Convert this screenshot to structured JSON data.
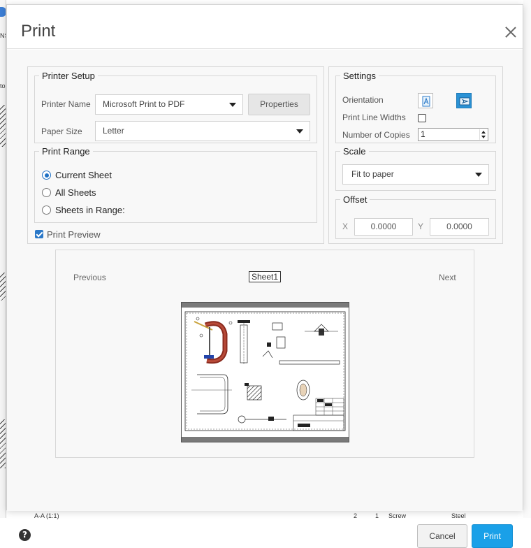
{
  "dialog": {
    "title": "Print"
  },
  "printer_setup": {
    "legend": "Printer Setup",
    "printer_name_label": "Printer Name",
    "printer_name_value": "Microsoft Print to PDF",
    "properties_button": "Properties",
    "paper_size_label": "Paper Size",
    "paper_size_value": "Letter"
  },
  "print_range": {
    "legend": "Print Range",
    "options": [
      {
        "label": "Current Sheet",
        "selected": true
      },
      {
        "label": "All Sheets",
        "selected": false
      },
      {
        "label": "Sheets in Range:",
        "selected": false
      }
    ]
  },
  "print_preview": {
    "label": "Print Preview",
    "checked": true
  },
  "settings": {
    "legend": "Settings",
    "orientation_label": "Orientation",
    "orientation_selected": "landscape",
    "line_widths_label": "Print Line Widths",
    "line_widths_checked": false,
    "copies_label": "Number of Copies",
    "copies_value": "1"
  },
  "scale": {
    "legend": "Scale",
    "value": "Fit to paper"
  },
  "offset": {
    "legend": "Offset",
    "x_label": "X",
    "x_value": "0.0000",
    "y_label": "Y",
    "y_value": "0.0000"
  },
  "preview": {
    "previous": "Previous",
    "sheet": "Sheet1",
    "next": "Next"
  },
  "footer": {
    "help": "?",
    "cancel": "Cancel",
    "print": "Print"
  },
  "background": {
    "left_text_1": "NS",
    "left_text_2": "to",
    "bottom_text_1": "A-A (1:1)",
    "bottom_text_2": "2",
    "bottom_text_3": "1",
    "bottom_text_4": "Screw",
    "bottom_text_5": "Steel"
  },
  "colors": {
    "accent": "#1aa0e8",
    "radio_check": "#1e70c4",
    "orientation_active": "#2a92d5"
  }
}
